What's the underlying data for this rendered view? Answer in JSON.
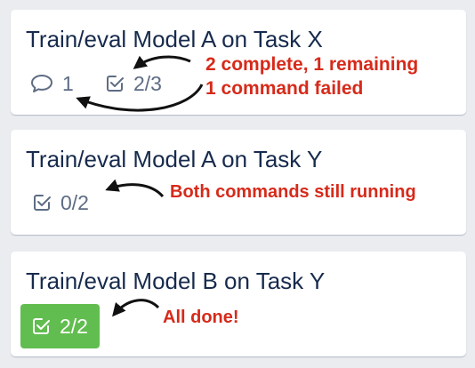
{
  "cards": [
    {
      "title": "Train/eval Model A on Task X",
      "comments": "1",
      "checklist": "2/3"
    },
    {
      "title": "Train/eval Model A on Task Y",
      "checklist": "0/2"
    },
    {
      "title": "Train/eval Model B on Task Y",
      "checklist": "2/2"
    }
  ],
  "annotations": {
    "card1_line1": "2 complete, 1 remaining",
    "card1_line2": "1 command failed",
    "card2": "Both commands still running",
    "card3": "All done!"
  },
  "colors": {
    "board_background": "#ebecf0",
    "card_background": "#ffffff",
    "title_text": "#172b4d",
    "badge_text": "#5e6c84",
    "complete_badge": "#61bd4f",
    "annotation_text": "#d62a1a",
    "arrow": "#111111"
  },
  "icons": {
    "comment": "comment-icon",
    "checklist": "checklist-icon"
  }
}
